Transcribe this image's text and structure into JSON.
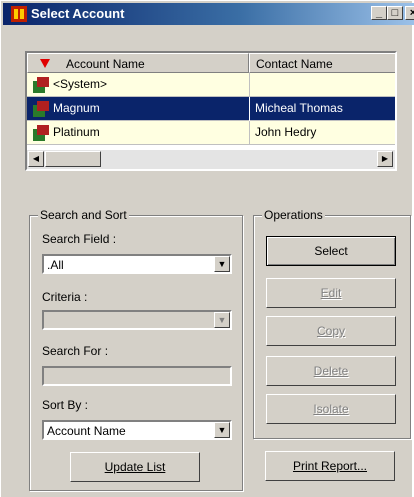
{
  "window": {
    "title": "Select Account",
    "controls": {
      "minimize": "_",
      "maximize": "□",
      "close": "×"
    }
  },
  "grid": {
    "columns": [
      "Account Name",
      "Contact Name"
    ],
    "rows": [
      {
        "account": "<System>",
        "contact": "",
        "selected": false
      },
      {
        "account": "Magnum",
        "contact": "Micheal Thomas",
        "selected": true
      },
      {
        "account": "Platinum",
        "contact": "John Hedry",
        "selected": false
      }
    ]
  },
  "search_sort": {
    "legend": "Search and Sort",
    "search_field_label": "Search Field :",
    "search_field_value": ".All",
    "criteria_label": "Criteria :",
    "criteria_value": "",
    "search_for_label": "Search For :",
    "search_for_value": "",
    "sort_by_label": "Sort By :",
    "sort_by_value": "Account Name",
    "update_button": "Update List"
  },
  "operations": {
    "legend": "Operations",
    "select": "Select",
    "edit": "Edit",
    "copy": "Copy",
    "delete": "Delete",
    "isolate": "Isolate",
    "print_report": "Print Report..."
  },
  "colors": {
    "title_start": "#0a246a",
    "title_end": "#a6caf0",
    "selection": "#0a246a",
    "row_background": "#ffffe1",
    "face": "#d4d0c8"
  }
}
